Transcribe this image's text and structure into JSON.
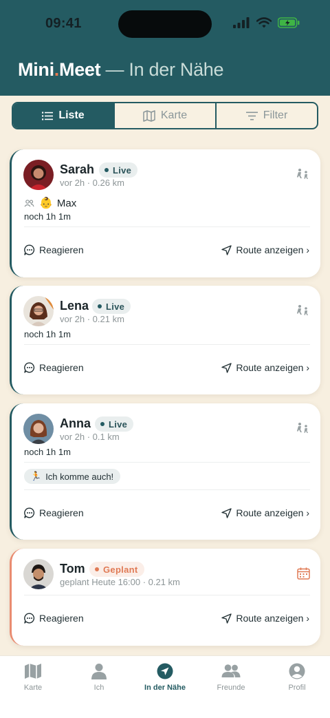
{
  "status_bar": {
    "time": "09:41"
  },
  "header": {
    "brand_part1": "Mini",
    "brand_dot": ".",
    "brand_part2": "Meet",
    "subtitle": " — In der Nähe"
  },
  "segments": [
    {
      "label": "Liste",
      "icon": "list-icon",
      "active": true
    },
    {
      "label": "Karte",
      "icon": "map-icon",
      "active": false
    },
    {
      "label": "Filter",
      "icon": "filter-icon",
      "active": false
    }
  ],
  "cards": [
    {
      "name": "Sarah",
      "badge": "Live",
      "meta": "vor 2h · 0.26 km",
      "group_emoji": "👶",
      "group_member": "Max",
      "remaining": "noch 1h 1m",
      "react": "Reagieren",
      "route": "Route anzeigen ›"
    },
    {
      "name": "Lena",
      "badge": "Live",
      "meta": "vor 2h · 0.21 km",
      "remaining": "noch 1h 1m",
      "react": "Reagieren",
      "route": "Route anzeigen ›"
    },
    {
      "name": "Anna",
      "badge": "Live",
      "meta": "vor 2h · 0.1 km",
      "remaining": "noch 1h 1m",
      "chip_emoji": "🏃",
      "chip": "Ich komme auch!",
      "react": "Reagieren",
      "route": "Route anzeigen ›"
    },
    {
      "name": "Tom",
      "badge": "Geplant",
      "meta": "geplant Heute 16:00 · 0.21 km",
      "react": "Reagieren",
      "route": "Route anzeigen ›"
    }
  ],
  "tabs": [
    {
      "label": "Karte",
      "icon": "map-icon",
      "active": false
    },
    {
      "label": "Ich",
      "icon": "person-icon",
      "active": false
    },
    {
      "label": "In der Nähe",
      "icon": "location-arrow-icon",
      "active": true
    },
    {
      "label": "Freunde",
      "icon": "friends-icon",
      "active": false
    },
    {
      "label": "Profil",
      "icon": "profile-icon",
      "active": false
    }
  ],
  "colors": {
    "header": "#245b62",
    "background": "#f7efe0",
    "accent": "#e6794f",
    "planned": "#e98b70"
  }
}
